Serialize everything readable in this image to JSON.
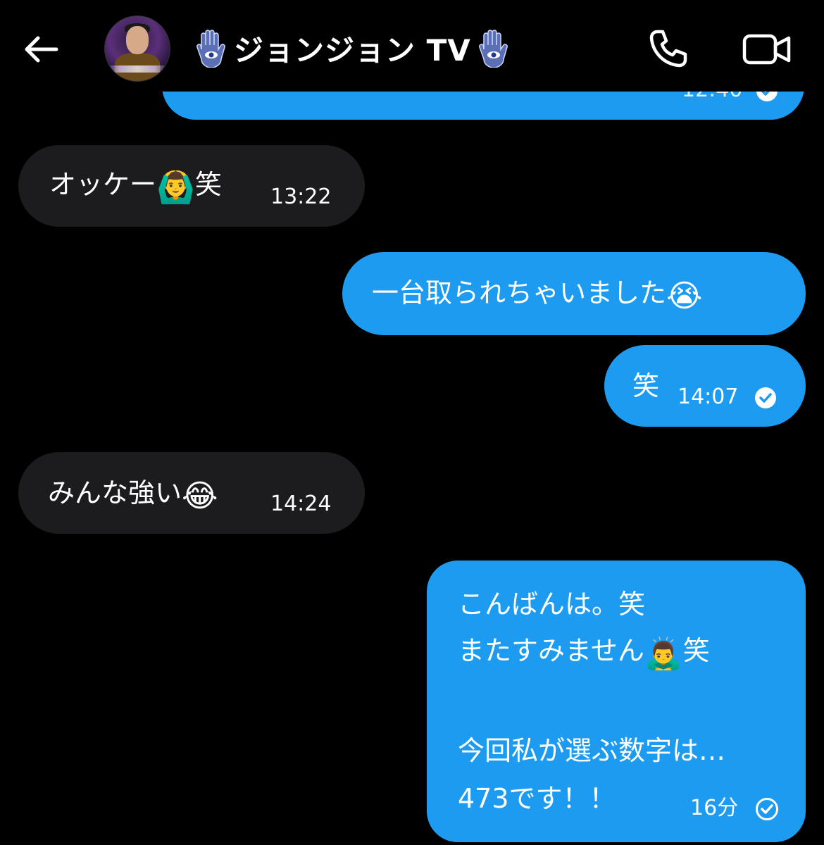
{
  "header": {
    "back_icon": "arrow-left-icon",
    "title": "ジョンジョン TV",
    "title_emoji": "hamsa-icon",
    "call_icon": "phone-icon",
    "video_icon": "video-camera-icon"
  },
  "messages": [
    {
      "direction": "out",
      "text": "",
      "time": "12:40",
      "read": true,
      "partially_visible": true
    },
    {
      "direction": "in",
      "text_before": "オッケー",
      "emoji": "🙆‍♂️",
      "text_after": "笑",
      "time": "13:22"
    },
    {
      "direction": "out",
      "text": "一台取られちゃいました",
      "emoji": "😭"
    },
    {
      "direction": "out",
      "text": "笑",
      "time": "14:07",
      "read": true
    },
    {
      "direction": "in",
      "text": "みんな強い",
      "emoji": "😂",
      "time": "14:24"
    },
    {
      "direction": "out",
      "lines": [
        "こんばんは。笑",
        "またすみません",
        "",
        "今回私が選ぶ数字は…",
        "473です！！"
      ],
      "line2_emoji": "🙇‍♂️",
      "line2_after": "笑",
      "time": "16分",
      "read": true
    }
  ],
  "colors": {
    "background": "#000000",
    "incoming_bubble": "#1c1c1e",
    "outgoing_bubble": "#1d9bf0",
    "text": "#ffffff"
  }
}
